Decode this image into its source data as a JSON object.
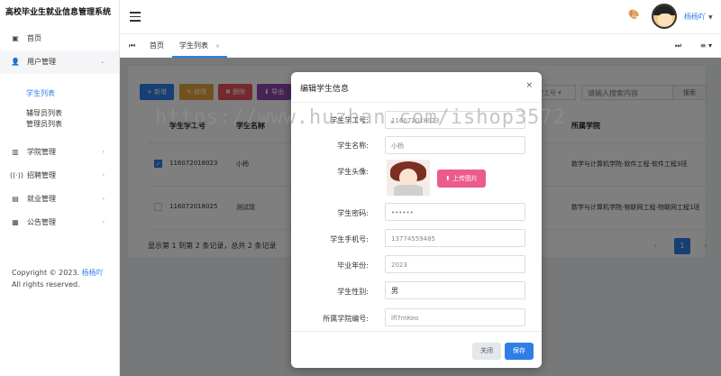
{
  "app": {
    "title": "高校毕业生就业信息管理系统"
  },
  "sidebar": {
    "items": [
      {
        "label": "首页"
      },
      {
        "label": "用户管理"
      },
      {
        "label": "学院管理"
      },
      {
        "label": "招聘管理"
      },
      {
        "label": "就业管理"
      },
      {
        "label": "公告管理"
      }
    ],
    "sub_items": [
      {
        "label": "学生列表"
      },
      {
        "label": "辅导员列表"
      },
      {
        "label": "管理员列表"
      }
    ],
    "copyright_prefix": "Copyright © 2023.",
    "copyright_author": "杨杨吖",
    "copyright_suffix": "All rights reserved."
  },
  "header": {
    "username": "杨杨吖"
  },
  "tabs": {
    "home": "首页",
    "student_list": "学生列表"
  },
  "toolbar": {
    "new_label": "+ 新增",
    "edit_label": "✎ 修改",
    "delete_label": "✖ 删除",
    "export_label": "⬇ 导出",
    "search_field": "学工号 ▾",
    "search_placeholder": "请输入搜索内容",
    "search_button": "搜索"
  },
  "table": {
    "headers": [
      "学生学工号",
      "学生名称",
      "所属学院"
    ],
    "rows": [
      {
        "id": "116072018023",
        "name": "小杨",
        "college": "数学与计算机学院-软件工程-软件工程3班",
        "checked": true
      },
      {
        "id": "116072018025",
        "name": "测试现",
        "college": "数学与计算机学院-物联网工程-物联网工程1班",
        "checked": false
      }
    ],
    "page_info": "显示第 1 到第 2 条记录，总共 2 条记录",
    "prev": "‹",
    "current_page": "1",
    "next": "›"
  },
  "modal": {
    "title": "编辑学生信息",
    "close": "×",
    "fields": {
      "student_no": {
        "label": "学生学工号:",
        "value": "116072018023"
      },
      "student_name": {
        "label": "学生名称:",
        "value": "小杨"
      },
      "avatar": {
        "label": "学生头像:"
      },
      "password": {
        "label": "学生密码:",
        "value": "••••••"
      },
      "phone": {
        "label": "学生手机号:",
        "value": "13774559485"
      },
      "grad_year": {
        "label": "毕业年份:",
        "value": "2023"
      },
      "gender": {
        "label": "学生性别:",
        "value": "男"
      },
      "college_code": {
        "label": "所属学院编号:",
        "value": "lfl7mKeo"
      }
    },
    "upload_label": "⬆ 上传图片",
    "close_button": "关闭",
    "save_button": "保存"
  },
  "watermark": "https://www.huzhan.com/ishop3572",
  "colors": {
    "accent": "#2f7ee6",
    "warning": "#e6a23c",
    "danger": "#e7525a",
    "upload": "#ec5b8d"
  }
}
